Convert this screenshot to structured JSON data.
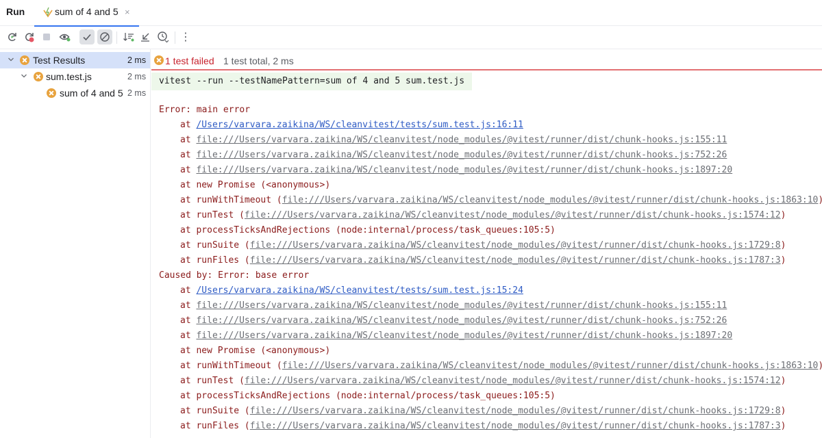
{
  "header": {
    "run_label": "Run",
    "tab_title": "sum of 4 and 5",
    "close_glyph": "×"
  },
  "toolbar": {
    "buttons": [
      "rerun-icon",
      "rerun-failed-icon",
      "stop-icon",
      "eye-icon",
      "show-passed-icon",
      "show-ignored-icon",
      "sort-icon",
      "collapse-icon",
      "history-icon",
      "more-icon"
    ],
    "more_glyph": "⋮"
  },
  "tree": {
    "root": {
      "label": "Test Results",
      "time": "2 ms"
    },
    "file": {
      "label": "sum.test.js",
      "time": "2 ms"
    },
    "test": {
      "label": "sum of 4 and 5",
      "time": "2 ms"
    }
  },
  "status": {
    "failed": "1 test failed",
    "total": "1 test total, 2 ms"
  },
  "console": {
    "command": "vitest --run --testNamePattern=sum of 4 and 5 sum.test.js",
    "lines": [
      {
        "kind": "text",
        "text": "Error: main error"
      },
      {
        "kind": "link",
        "prefix": "at ",
        "link": "/Users/varvara.zaikina/WS/cleanvitest/tests/sum.test.js:16:11",
        "suffix": ""
      },
      {
        "kind": "gray",
        "prefix": "at ",
        "link": "file:///Users/varvara.zaikina/WS/cleanvitest/node_modules/@vitest/runner/dist/chunk-hooks.js:155:11",
        "suffix": ""
      },
      {
        "kind": "gray",
        "prefix": "at ",
        "link": "file:///Users/varvara.zaikina/WS/cleanvitest/node_modules/@vitest/runner/dist/chunk-hooks.js:752:26",
        "suffix": ""
      },
      {
        "kind": "gray",
        "prefix": "at ",
        "link": "file:///Users/varvara.zaikina/WS/cleanvitest/node_modules/@vitest/runner/dist/chunk-hooks.js:1897:20",
        "suffix": ""
      },
      {
        "kind": "plain",
        "prefix": "at ",
        "link": "",
        "suffix": "new Promise (<anonymous>)"
      },
      {
        "kind": "gray",
        "prefix": "at runWithTimeout (",
        "link": "file:///Users/varvara.zaikina/WS/cleanvitest/node_modules/@vitest/runner/dist/chunk-hooks.js:1863:10",
        "suffix": ")"
      },
      {
        "kind": "gray",
        "prefix": "at runTest (",
        "link": "file:///Users/varvara.zaikina/WS/cleanvitest/node_modules/@vitest/runner/dist/chunk-hooks.js:1574:12",
        "suffix": ")"
      },
      {
        "kind": "plain",
        "prefix": "at ",
        "link": "",
        "suffix": "processTicksAndRejections (node:internal/process/task_queues:105:5)"
      },
      {
        "kind": "gray",
        "prefix": "at runSuite (",
        "link": "file:///Users/varvara.zaikina/WS/cleanvitest/node_modules/@vitest/runner/dist/chunk-hooks.js:1729:8",
        "suffix": ")"
      },
      {
        "kind": "gray",
        "prefix": "at runFiles (",
        "link": "file:///Users/varvara.zaikina/WS/cleanvitest/node_modules/@vitest/runner/dist/chunk-hooks.js:1787:3",
        "suffix": ")"
      },
      {
        "kind": "text",
        "text": "Caused by: Error: base error"
      },
      {
        "kind": "link",
        "prefix": "at ",
        "link": "/Users/varvara.zaikina/WS/cleanvitest/tests/sum.test.js:15:24",
        "suffix": ""
      },
      {
        "kind": "gray",
        "prefix": "at ",
        "link": "file:///Users/varvara.zaikina/WS/cleanvitest/node_modules/@vitest/runner/dist/chunk-hooks.js:155:11",
        "suffix": ""
      },
      {
        "kind": "gray",
        "prefix": "at ",
        "link": "file:///Users/varvara.zaikina/WS/cleanvitest/node_modules/@vitest/runner/dist/chunk-hooks.js:752:26",
        "suffix": ""
      },
      {
        "kind": "gray",
        "prefix": "at ",
        "link": "file:///Users/varvara.zaikina/WS/cleanvitest/node_modules/@vitest/runner/dist/chunk-hooks.js:1897:20",
        "suffix": ""
      },
      {
        "kind": "plain",
        "prefix": "at ",
        "link": "",
        "suffix": "new Promise (<anonymous>)"
      },
      {
        "kind": "gray",
        "prefix": "at runWithTimeout (",
        "link": "file:///Users/varvara.zaikina/WS/cleanvitest/node_modules/@vitest/runner/dist/chunk-hooks.js:1863:10",
        "suffix": ")"
      },
      {
        "kind": "gray",
        "prefix": "at runTest (",
        "link": "file:///Users/varvara.zaikina/WS/cleanvitest/node_modules/@vitest/runner/dist/chunk-hooks.js:1574:12",
        "suffix": ")"
      },
      {
        "kind": "plain",
        "prefix": "at ",
        "link": "",
        "suffix": "processTicksAndRejections (node:internal/process/task_queues:105:5)"
      },
      {
        "kind": "gray",
        "prefix": "at runSuite (",
        "link": "file:///Users/varvara.zaikina/WS/cleanvitest/node_modules/@vitest/runner/dist/chunk-hooks.js:1729:8",
        "suffix": ")"
      },
      {
        "kind": "gray",
        "prefix": "at runFiles (",
        "link": "file:///Users/varvara.zaikina/WS/cleanvitest/node_modules/@vitest/runner/dist/chunk-hooks.js:1787:3",
        "suffix": ")"
      }
    ]
  },
  "colors": {
    "accent": "#3574f0",
    "fail_icon": "#e8a33e",
    "fail_text": "#c7222d",
    "error_text": "#8b1b1b",
    "link": "#2e5bc4",
    "selected_row": "#d5e1f9"
  }
}
